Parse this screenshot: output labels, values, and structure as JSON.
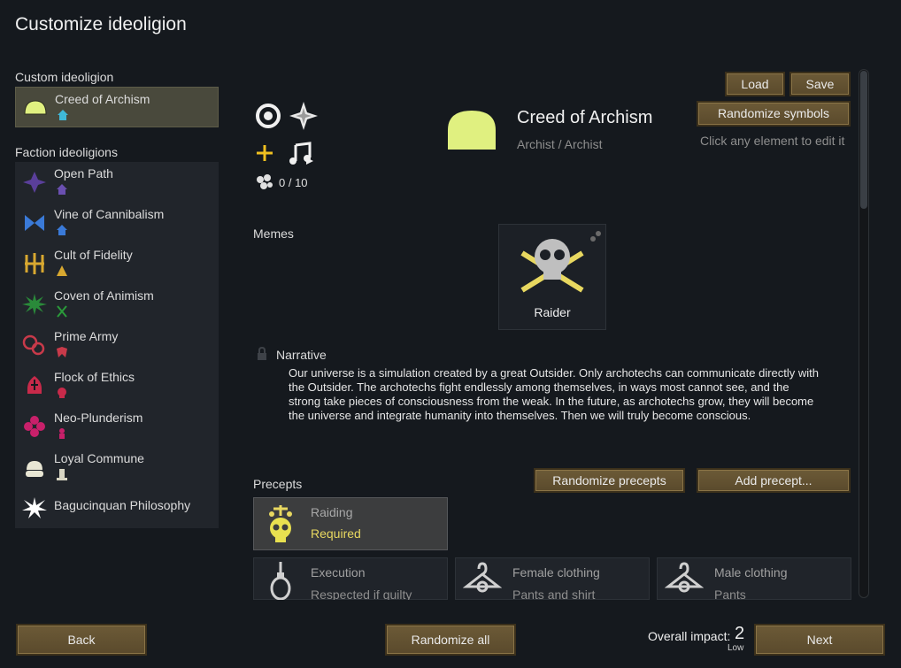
{
  "window": {
    "title": "Customize ideoligion"
  },
  "sidebar": {
    "custom_label": "Custom ideoligion",
    "custom_item": {
      "label": "Creed of Archism"
    },
    "faction_label": "Faction ideoligions",
    "items": [
      {
        "label": "Open Path"
      },
      {
        "label": "Vine of Cannibalism"
      },
      {
        "label": "Cult of Fidelity"
      },
      {
        "label": "Coven of Animism"
      },
      {
        "label": "Prime Army"
      },
      {
        "label": "Flock of Ethics"
      },
      {
        "label": "Neo-Plunderism"
      },
      {
        "label": "Loyal Commune"
      },
      {
        "label": "Bagucinquan Philosophy"
      }
    ]
  },
  "header": {
    "name": "Creed of Archism",
    "subtitle": "Archist / Archist",
    "hint": "Click any element to edit it",
    "followers": "0 / 10",
    "load_label": "Load",
    "save_label": "Save",
    "randomize_symbols_label": "Randomize symbols"
  },
  "memes": {
    "label": "Memes",
    "items": [
      {
        "label": "Raider"
      }
    ]
  },
  "narrative": {
    "label": "Narrative",
    "text": "Our universe is a simulation created by a great Outsider. Only archotechs can communicate directly with the Outsider. The archotechs fight endlessly among themselves, in ways most cannot see, and the strong take pieces of consciousness from the weak. In the future, as archotechs grow, they will become the universe and integrate humanity into themselves. Then we will truly become conscious."
  },
  "precepts": {
    "label": "Precepts",
    "randomize_label": "Randomize precepts",
    "add_label": "Add precept...",
    "items": [
      {
        "title": "Raiding",
        "value": "Required"
      },
      {
        "title": "Execution",
        "value": "Respected if guilty"
      },
      {
        "title": "Female clothing",
        "value": "Pants and shirt"
      },
      {
        "title": "Male clothing",
        "value": "Pants"
      }
    ]
  },
  "footer": {
    "back_label": "Back",
    "randomize_all_label": "Randomize all",
    "impact_label": "Overall impact:",
    "impact_value": "2",
    "impact_level": "Low",
    "next_label": "Next"
  },
  "colors": {
    "accent_yellow": "#e0f080",
    "required_text": "#e8d860",
    "button_brown": "#6c5a37",
    "selected_bg": "#49493c"
  },
  "icons": {
    "ideo_icon": "dome-icon",
    "open_path": "four-point-star-icon",
    "vine": "butterfly-icon",
    "cult": "candelabra-icon",
    "coven": "spiky-star-icon",
    "prime_army": "linked-rings-icon",
    "flock": "mitre-icon",
    "neo_plunderism": "flower-cross-icon",
    "loyal_commune": "bulb-icon",
    "bagucinquan": "burst-star-icon"
  }
}
